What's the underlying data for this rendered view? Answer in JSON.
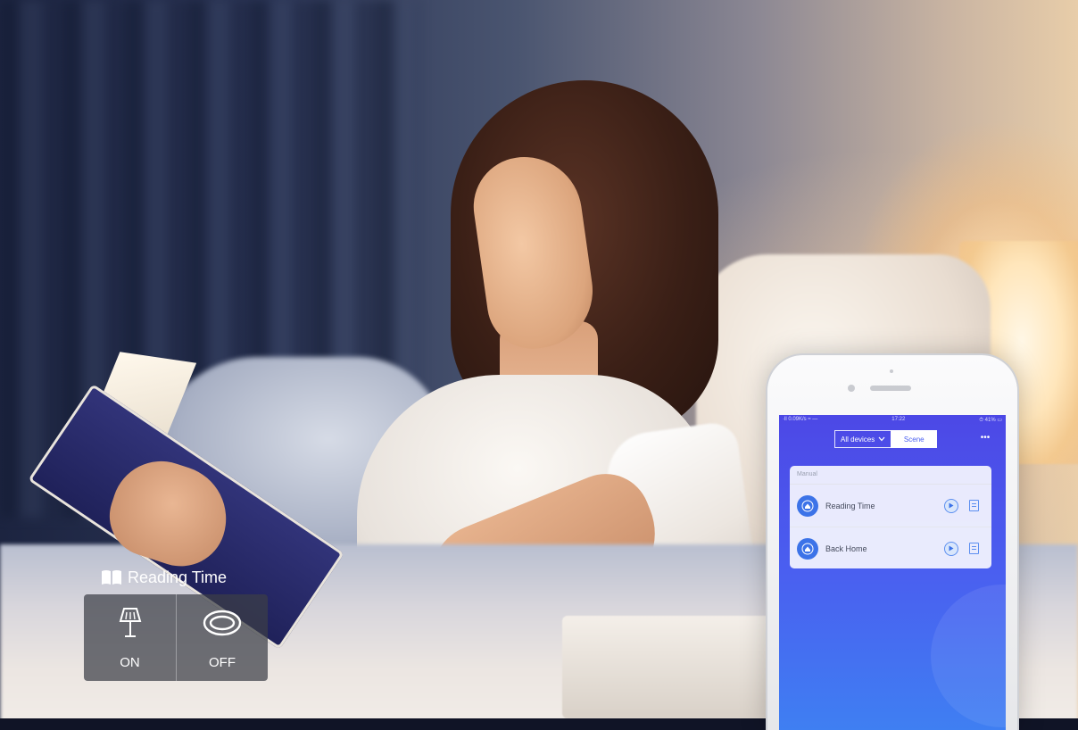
{
  "overlay": {
    "scene_label": "Reading Time",
    "toggles": [
      {
        "label": "ON",
        "icon": "table-lamp-icon"
      },
      {
        "label": "OFF",
        "icon": "ceiling-light-icon"
      }
    ]
  },
  "phone": {
    "status_bar": {
      "left": "·ll 0.09K/s ≈ —",
      "time": "17:22",
      "right": "⏱ 41% ▭"
    },
    "tabs": {
      "all_devices": "All devices",
      "scene": "Scene"
    },
    "more": "•••",
    "card": {
      "header": "Manual",
      "rows": [
        {
          "name": "Reading Time"
        },
        {
          "name": "Back Home"
        }
      ]
    }
  },
  "colors": {
    "app_gradient_top": "#4c48e6",
    "app_gradient_bottom": "#3f7ff2",
    "scene_icon": "#3c73e8"
  }
}
